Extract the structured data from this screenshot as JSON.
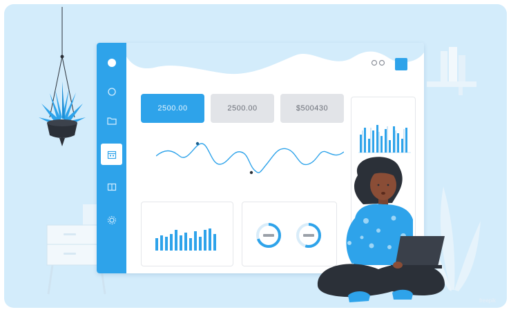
{
  "dashboard": {
    "stat_cards": [
      {
        "value": "2500.00",
        "style": "primary"
      },
      {
        "value": "2500.00",
        "style": "secondary"
      },
      {
        "value": "$500430",
        "style": "secondary"
      }
    ],
    "sidebar_icons": [
      "circle-icon",
      "folder-icon",
      "calendar-icon",
      "image-icon",
      "settings-icon"
    ],
    "active_sidebar_index": 2
  },
  "colors": {
    "background": "#d3ecfb",
    "accent": "#2ea3ea",
    "card_gray": "#e2e4e8",
    "dark": "#2b3038"
  },
  "watermark": "freepik"
}
